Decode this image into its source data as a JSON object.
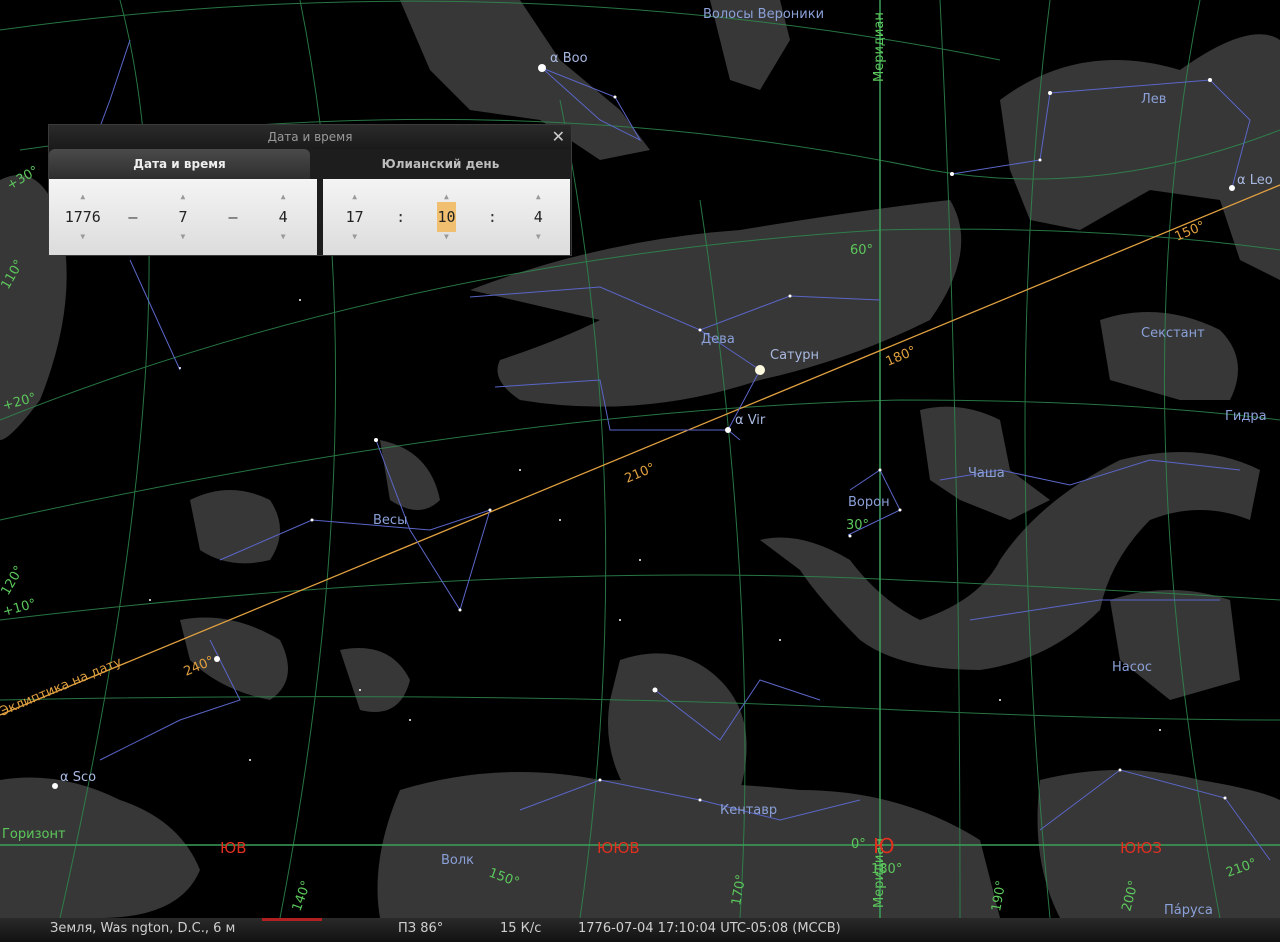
{
  "dialog": {
    "title": "Дата и время",
    "close_glyph": "✕",
    "tabs": [
      {
        "label": "Дата и время",
        "active": true
      },
      {
        "label": "Юлианский день",
        "active": false
      }
    ],
    "date": {
      "year": "1776",
      "month": "7",
      "day": "4",
      "separator": "–"
    },
    "time": {
      "hour": "17",
      "minute": "10",
      "second": "4",
      "separator": ":"
    }
  },
  "sky": {
    "constellations": [
      "Волосы Вероники",
      "Лев",
      "Дева",
      "Секстант",
      "Гидра",
      "Чаша",
      "Ворон",
      "Весы",
      "Насос",
      "Кентавр",
      "Волк",
      "Па́руса"
    ],
    "stars": [
      "α Boo",
      "α Leo",
      "Сатурн",
      "α Vir",
      "α Sco"
    ],
    "meridian_label": "Меридиан",
    "horizon_label": "Горизонт",
    "ecliptic_label": "Эклиптика на дату",
    "ecliptic_marks": [
      "150°",
      "180°",
      "210°",
      "240°"
    ],
    "grid_labels": [
      "60°",
      "30°",
      "0°",
      "180°",
      "150°",
      "170°",
      "140°",
      "+10°",
      "+20°",
      "120°",
      "110°",
      "+30°",
      "210°",
      "200°",
      "190°"
    ],
    "cardinals": [
      "ЮВ",
      "ЮЮВ",
      "Ю",
      "ЮЮЗ"
    ]
  },
  "status": {
    "location": "Земля, Was  ngton, D.C., 6 м",
    "fov": "ПЗ 86°",
    "fps": "15 К/с",
    "datetime": "1776-07-04 17:10:04 UTC-05:08 (МССВ)"
  },
  "colors": {
    "grid": "#3aa05a",
    "ecliptic": "#e0a040",
    "constellation_lines": "#5a66c8",
    "cardinal": "#e03020"
  }
}
